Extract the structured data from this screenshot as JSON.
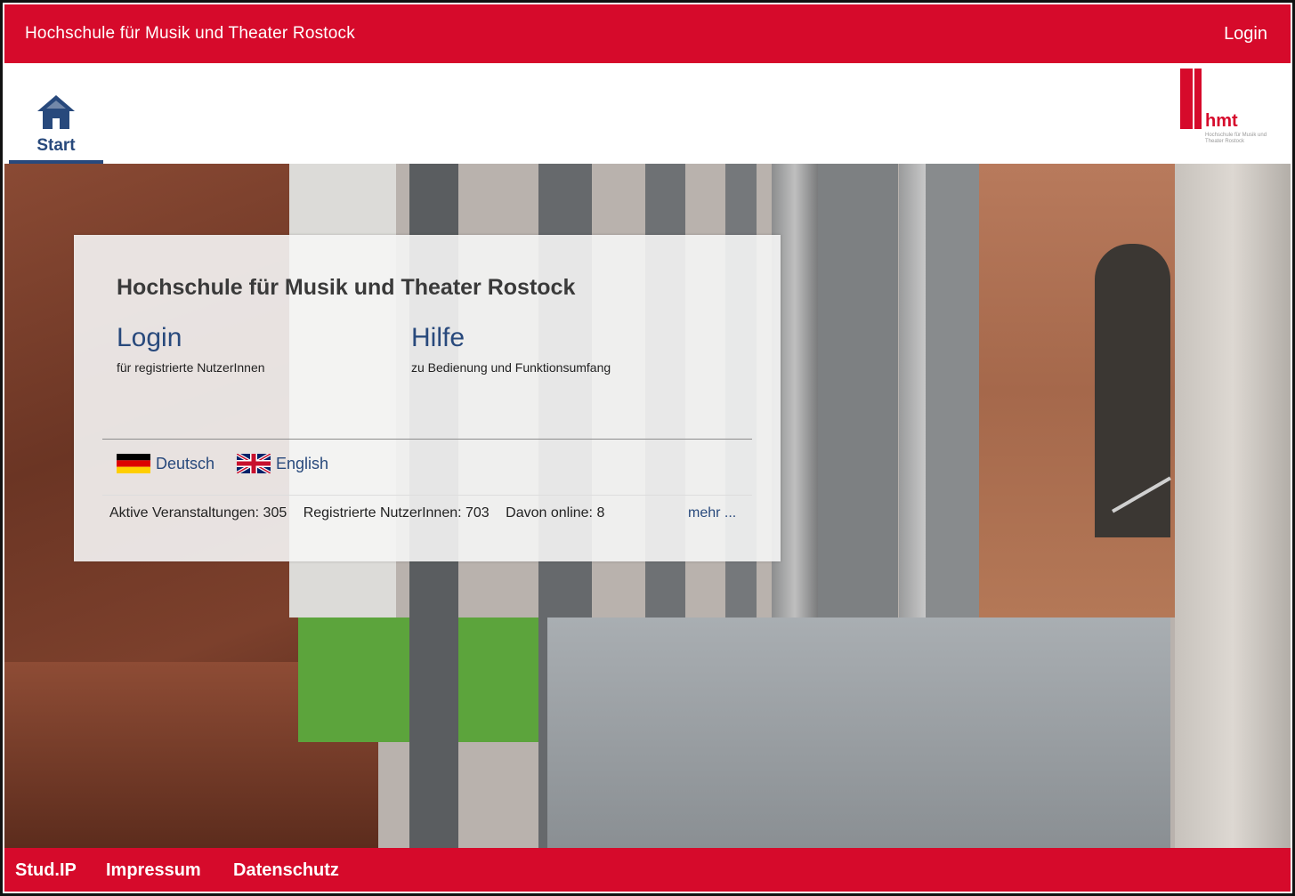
{
  "header": {
    "title": "Hochschule für Musik und Theater Rostock",
    "login_label": "Login"
  },
  "nav": {
    "start_label": "Start",
    "logo_word": "hmt",
    "logo_sub": "Hochschule für Musik und Theater Rostock"
  },
  "main": {
    "heading": "Hochschule für Musik und Theater Rostock",
    "login_title": "Login",
    "login_desc": "für registrierte NutzerInnen",
    "help_title": "Hilfe",
    "help_desc": "zu Bedienung und Funktionsumfang",
    "languages": [
      "Deutsch",
      "English"
    ],
    "stats": {
      "active_courses": "Aktive Veranstaltungen: 305",
      "registered_users": "Registrierte NutzerInnen: 703",
      "online": "Davon online: 8",
      "more": "mehr ..."
    }
  },
  "footer": {
    "links": [
      "Stud.IP",
      "Impressum",
      "Datenschutz"
    ]
  },
  "colors": {
    "brand_red": "#d60a2b",
    "link_blue": "#28497c"
  }
}
